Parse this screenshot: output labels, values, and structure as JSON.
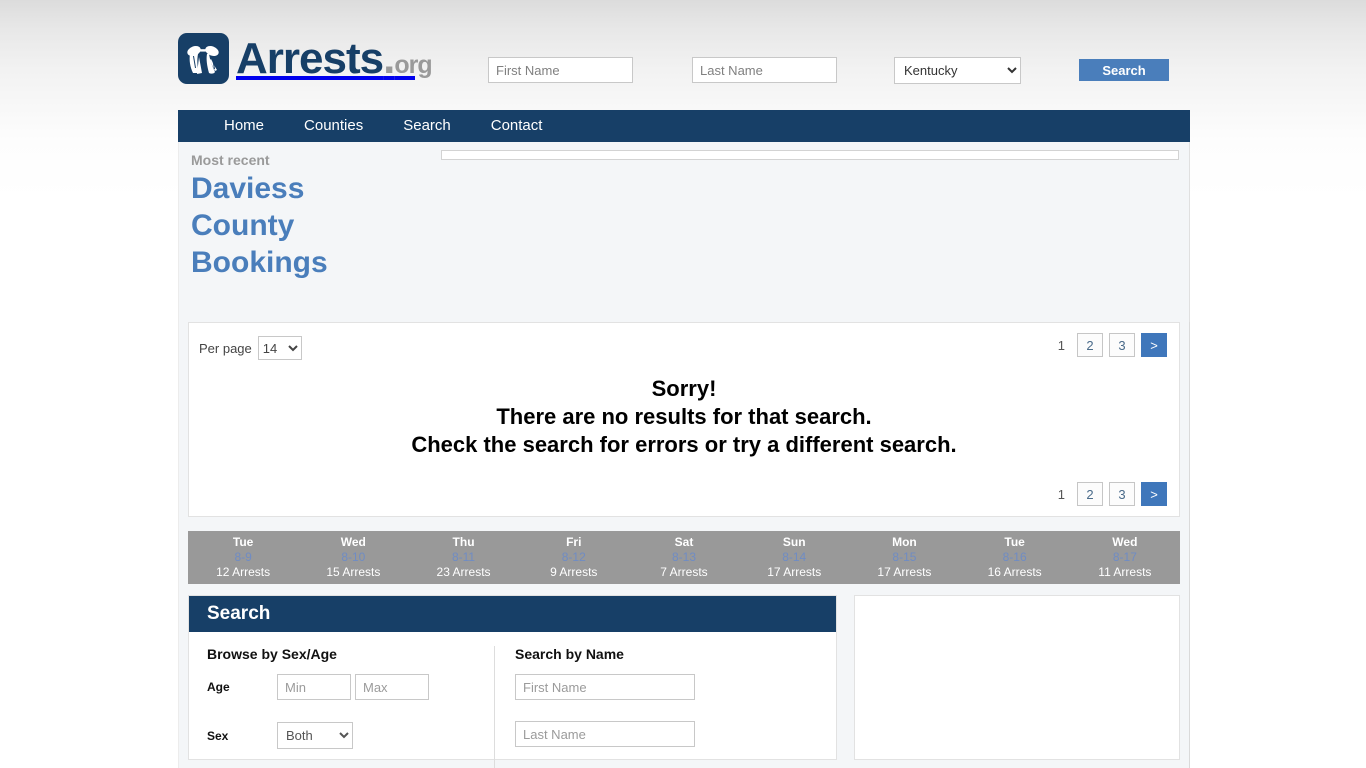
{
  "header": {
    "logo_icon": "handcuffs-icon",
    "brand_main": "Arrests",
    "brand_dot": ".",
    "brand_org": "org",
    "first_name_placeholder": "First Name",
    "first_name_value": "",
    "last_name_placeholder": "Last Name",
    "last_name_value": "",
    "state_selected": "Kentucky",
    "state_options": [
      "Kentucky"
    ],
    "search_label": "Search"
  },
  "nav": {
    "items": [
      {
        "label": "Home"
      },
      {
        "label": "Counties"
      },
      {
        "label": "Search"
      },
      {
        "label": "Contact"
      }
    ]
  },
  "hero": {
    "eyebrow": "Most recent",
    "title": "Daviess County Bookings"
  },
  "results": {
    "per_page_label": "Per page",
    "per_page_value": "14",
    "per_page_options": [
      "14"
    ],
    "pagination": {
      "current": "1",
      "pages": [
        "2",
        "3"
      ],
      "next_label": ">"
    },
    "message_line1": "Sorry!",
    "message_line2": "There are no results for that search.",
    "message_line3": "Check the search for errors or try a different search."
  },
  "date_strip": {
    "days": [
      {
        "name": "Tue",
        "date": "8-9",
        "count": "12 Arrests"
      },
      {
        "name": "Wed",
        "date": "8-10",
        "count": "15 Arrests"
      },
      {
        "name": "Thu",
        "date": "8-11",
        "count": "23 Arrests"
      },
      {
        "name": "Fri",
        "date": "8-12",
        "count": "9 Arrests"
      },
      {
        "name": "Sat",
        "date": "8-13",
        "count": "7 Arrests"
      },
      {
        "name": "Sun",
        "date": "8-14",
        "count": "17 Arrests"
      },
      {
        "name": "Mon",
        "date": "8-15",
        "count": "17 Arrests"
      },
      {
        "name": "Tue",
        "date": "8-16",
        "count": "16 Arrests"
      },
      {
        "name": "Wed",
        "date": "8-17",
        "count": "11 Arrests"
      }
    ]
  },
  "search_panel": {
    "title": "Search",
    "browse_heading": "Browse by Sex/Age",
    "age_label": "Age",
    "age_min_placeholder": "Min",
    "age_min_value": "",
    "age_max_placeholder": "Max",
    "age_max_value": "",
    "sex_label": "Sex",
    "sex_selected": "Both",
    "sex_options": [
      "Both"
    ],
    "name_heading": "Search by Name",
    "first_name_placeholder": "First Name",
    "first_name_value": "",
    "last_name_placeholder": "Last Name",
    "last_name_value": ""
  },
  "colors": {
    "brand_navy": "#173f67",
    "accent_blue": "#4a7ebb",
    "pager_blue": "#3f77bb",
    "strip_gray": "#999999",
    "page_bg": "#f4f6f8"
  }
}
